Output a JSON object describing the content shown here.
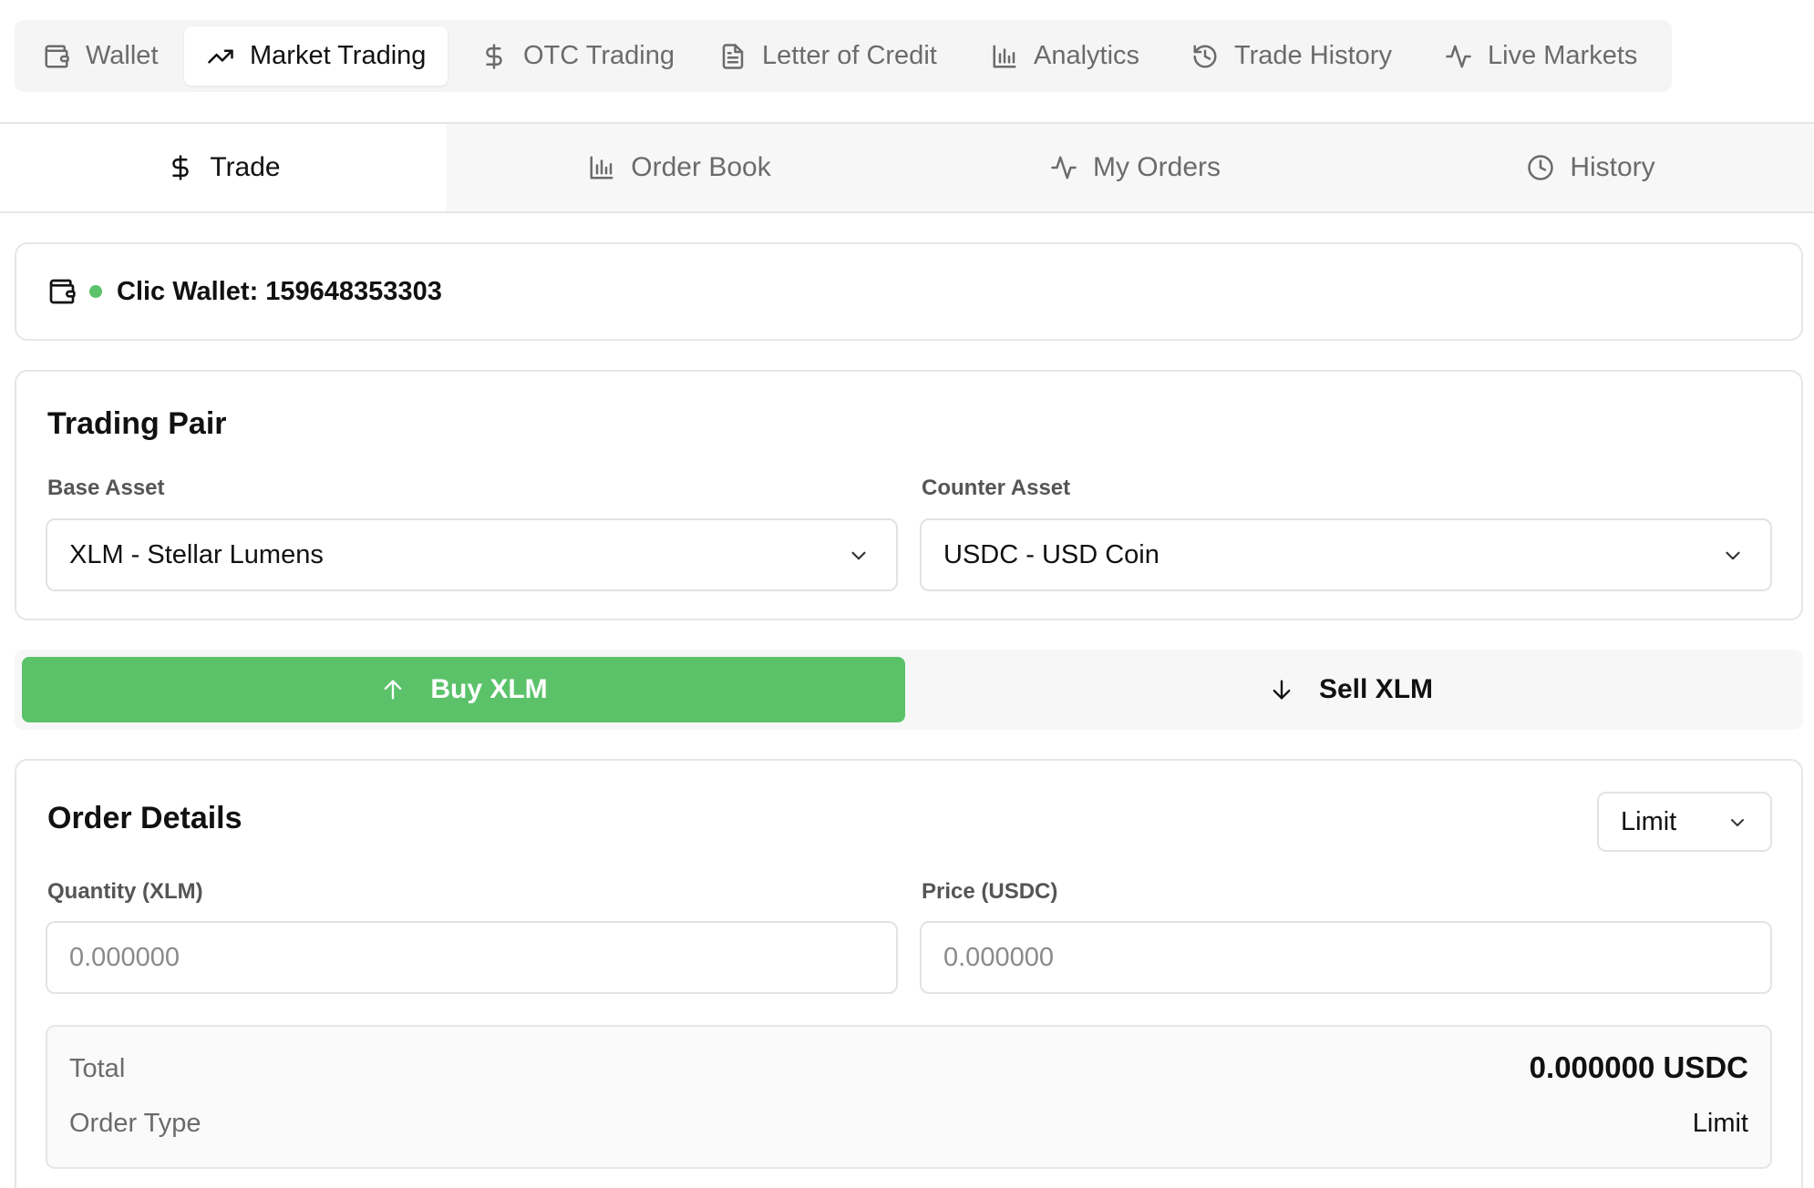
{
  "top_nav": {
    "tabs": [
      {
        "label": "Wallet",
        "icon": "wallet-icon"
      },
      {
        "label": "Market Trading",
        "icon": "trending-up-icon",
        "active": true
      },
      {
        "label": "OTC Trading",
        "icon": "dollar-icon"
      },
      {
        "label": "Letter of Credit",
        "icon": "document-icon"
      },
      {
        "label": "Analytics",
        "icon": "bar-chart-icon"
      },
      {
        "label": "Trade History",
        "icon": "history-icon"
      },
      {
        "label": "Live Markets",
        "icon": "activity-icon"
      }
    ]
  },
  "sub_nav": {
    "tabs": [
      {
        "label": "Trade",
        "icon": "dollar-icon",
        "active": true
      },
      {
        "label": "Order Book",
        "icon": "bar-chart-icon"
      },
      {
        "label": "My Orders",
        "icon": "activity-icon"
      },
      {
        "label": "History",
        "icon": "clock-icon"
      }
    ]
  },
  "wallet": {
    "label": "Clic Wallet: 159648353303",
    "status_color": "#5bc26a"
  },
  "trading_pair": {
    "title": "Trading Pair",
    "base_label": "Base Asset",
    "base_value": "XLM - Stellar Lumens",
    "counter_label": "Counter Asset",
    "counter_value": "USDC - USD Coin"
  },
  "side_toggle": {
    "buy_label": "Buy XLM",
    "sell_label": "Sell XLM",
    "selected": "buy",
    "accent_color": "#5bc26a"
  },
  "order_details": {
    "title": "Order Details",
    "order_type": "Limit",
    "quantity_label": "Quantity (XLM)",
    "quantity_placeholder": "0.000000",
    "price_label": "Price (USDC)",
    "price_placeholder": "0.000000",
    "summary": {
      "total_label": "Total",
      "total_value": "0.000000 USDC",
      "type_label": "Order Type",
      "type_value": "Limit"
    }
  }
}
